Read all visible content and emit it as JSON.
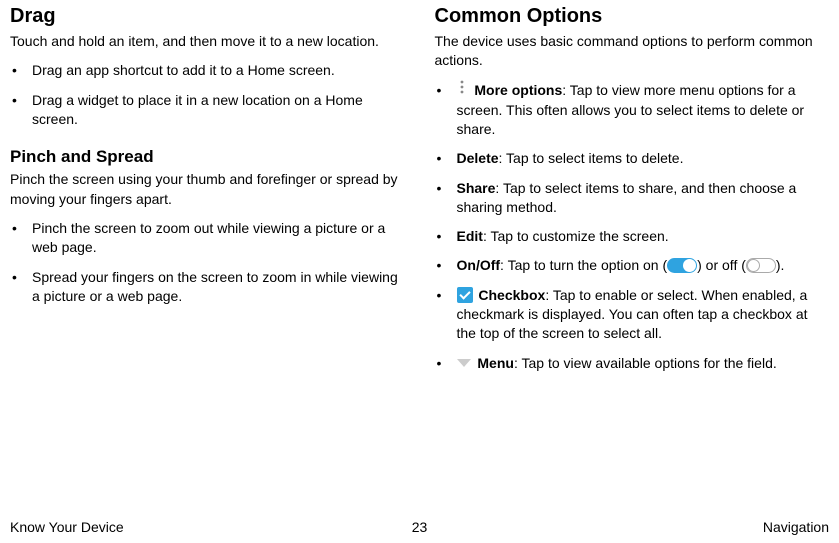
{
  "left": {
    "drag_heading": "Drag",
    "drag_intro": "Touch and hold an item, and then move it to a new location.",
    "drag_items": [
      "Drag an app shortcut to add it to a Home screen.",
      "Drag a widget to place it in a new location on a Home screen."
    ],
    "pinch_heading": "Pinch and Spread",
    "pinch_intro": "Pinch the screen using your thumb and forefinger or spread by moving your fingers apart.",
    "pinch_items": [
      "Pinch the screen to zoom out while viewing a picture or a web page.",
      "Spread your fingers on the screen to zoom in while viewing a picture or a web page."
    ]
  },
  "right": {
    "heading": "Common Options",
    "intro": "The device uses basic command options to perform common actions.",
    "more_label": "More options",
    "more_desc": ": Tap to view more menu options for a screen. This often allows you to select items to delete or share.",
    "delete_label": "Delete",
    "delete_desc": ": Tap to select items to delete.",
    "share_label": "Share",
    "share_desc": ": Tap to select items to share, and then choose a sharing method.",
    "edit_label": "Edit",
    "edit_desc": ": Tap to customize the screen.",
    "onoff_label": "On/Off",
    "onoff_desc_a": ": Tap to turn the option on (",
    "onoff_desc_b": ") or off (",
    "onoff_desc_c": ").",
    "checkbox_label": "Checkbox",
    "checkbox_desc": ": Tap to enable or select. When enabled, a checkmark is displayed. You can often tap a checkbox at the top of the screen to select all.",
    "menu_label": "Menu",
    "menu_desc": ": Tap to view available options for the field."
  },
  "footer": {
    "left": "Know Your Device",
    "center": "23",
    "right": "Navigation"
  }
}
